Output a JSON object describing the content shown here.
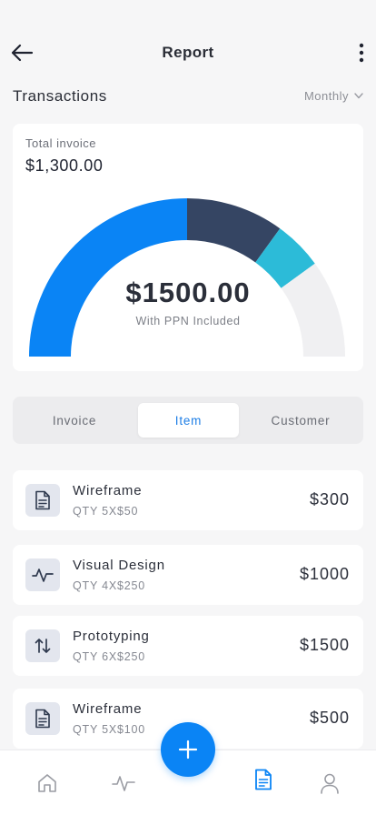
{
  "header": {
    "title": "Report"
  },
  "section": {
    "title": "Transactions",
    "period": "Monthly"
  },
  "summary": {
    "total_label": "Total invoice",
    "total_value": "$1,300.00",
    "gauge_value": "$1500.00",
    "gauge_caption": "With PPN Included",
    "gauge_segments": [
      {
        "fraction": 0.5,
        "color": "#0a84f5"
      },
      {
        "fraction": 0.2,
        "color": "#354563"
      },
      {
        "fraction": 0.1,
        "color": "#2cbbd8"
      },
      {
        "fraction": 0.2,
        "color": "#f0f0f2"
      }
    ]
  },
  "tabs": [
    {
      "label": "Invoice",
      "active": false
    },
    {
      "label": "Item",
      "active": true
    },
    {
      "label": "Customer",
      "active": false
    }
  ],
  "items": [
    {
      "name": "Wireframe",
      "qty": "QTY 5X$50",
      "amount": "$300",
      "icon": "document-icon"
    },
    {
      "name": "Visual Design",
      "qty": "QTY 4X$250",
      "amount": "$1000",
      "icon": "activity-icon"
    },
    {
      "name": "Prototyping",
      "qty": "QTY 6X$250",
      "amount": "$1500",
      "icon": "swap-arrows-icon"
    },
    {
      "name": "Wireframe",
      "qty": "QTY 5X$100",
      "amount": "$500",
      "icon": "document-icon"
    }
  ],
  "nav": {
    "items": [
      "home-icon",
      "activity-icon",
      "document-icon",
      "user-icon"
    ],
    "active": "document-icon"
  },
  "colors": {
    "accent": "#0a84f5",
    "dark_segment": "#354563",
    "cyan_segment": "#2cbbd8"
  }
}
